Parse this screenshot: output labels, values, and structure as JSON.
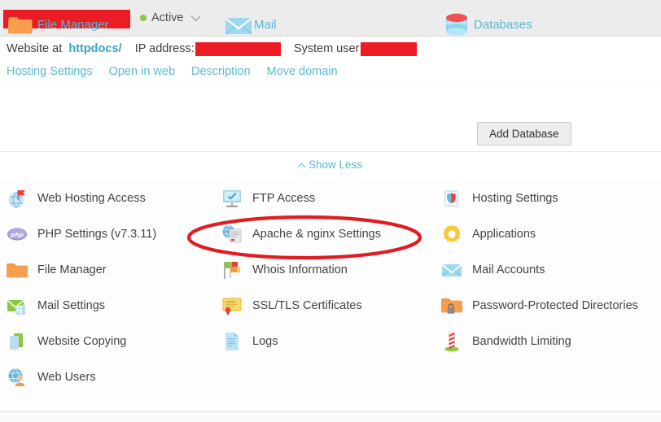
{
  "colors": {
    "link": "#5bb8d4",
    "link_bold": "#3aa2c4",
    "text": "#444444",
    "status_active": "#8cc63e",
    "redaction": "#ec1c24",
    "annotation": "#e01b22",
    "topbar_bg": "#ececec"
  },
  "topbar": {
    "domain_redacted": "",
    "status_label": "Active",
    "status_icon": "status-dot-icon",
    "caret_icon": "chevron-down-icon"
  },
  "info": {
    "website_at_label": "Website at",
    "httpdocs_link": "httpdocs/",
    "ip_label": "IP address:",
    "ip_value_redacted": "",
    "system_user_label": "System user:",
    "system_user_value_redacted": ""
  },
  "actions": [
    {
      "label": "Hosting Settings",
      "name": "action-hosting-settings"
    },
    {
      "label": "Open in web",
      "name": "action-open-in-web"
    },
    {
      "label": "Description",
      "name": "action-description"
    },
    {
      "label": "Move domain",
      "name": "action-move-domain"
    }
  ],
  "tiles": [
    {
      "label": "File Manager",
      "icon": "folder-icon"
    },
    {
      "label": "Mail",
      "icon": "envelope-icon"
    },
    {
      "label": "Databases",
      "icon": "database-icon"
    }
  ],
  "add_database_button": "Add Database",
  "show_less": {
    "label": "Show Less",
    "icon": "chevron-up-icon"
  },
  "tools": {
    "column_1": [
      {
        "label": "Web Hosting Access",
        "icon": "globe-flag-icon"
      },
      {
        "label": "PHP Settings (v7.3.11)",
        "icon": "php-icon"
      },
      {
        "label": "File Manager",
        "icon": "folder-icon"
      },
      {
        "label": "Mail Settings",
        "icon": "mail-settings-icon"
      },
      {
        "label": "Website Copying",
        "icon": "copy-pages-icon"
      },
      {
        "label": "Web Users",
        "icon": "web-users-icon"
      }
    ],
    "column_2": [
      {
        "label": "FTP Access",
        "icon": "ftp-icon"
      },
      {
        "label": "Apache & nginx Settings",
        "icon": "apache-nginx-icon"
      },
      {
        "label": "Whois Information",
        "icon": "whois-flags-icon"
      },
      {
        "label": "SSL/TLS Certificates",
        "icon": "certificate-icon"
      },
      {
        "label": "Logs",
        "icon": "document-lines-icon"
      }
    ],
    "column_3": [
      {
        "label": "Hosting Settings",
        "icon": "hosting-settings-icon"
      },
      {
        "label": "Applications",
        "icon": "gear-icon"
      },
      {
        "label": "Mail Accounts",
        "icon": "envelope-icon"
      },
      {
        "label": "Password-Protected Directories",
        "icon": "locked-folder-icon"
      },
      {
        "label": "Bandwidth Limiting",
        "icon": "bandwidth-post-icon"
      }
    ]
  },
  "annotation": {
    "shape": "ellipse",
    "target": "Apache & nginx Settings"
  }
}
